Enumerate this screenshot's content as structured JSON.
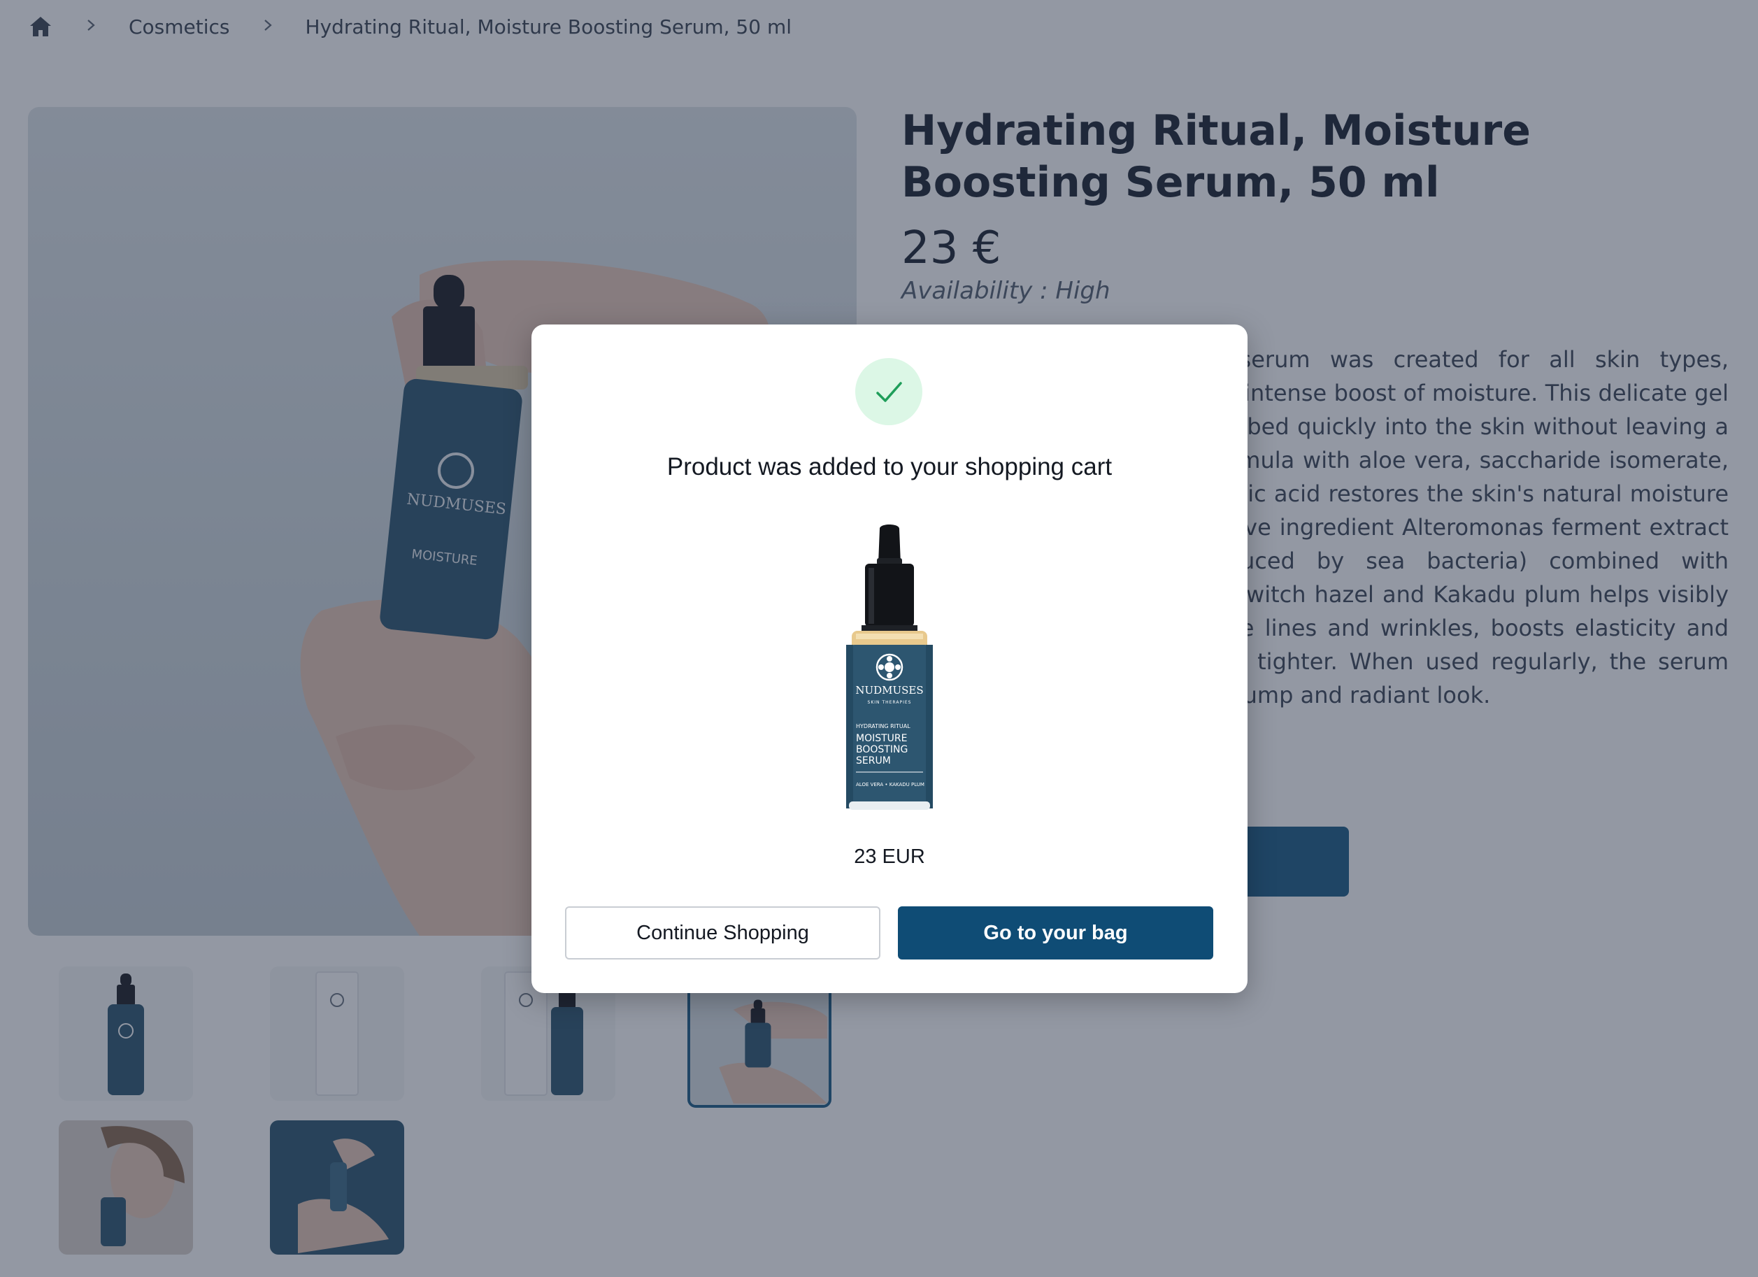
{
  "breadcrumb": {
    "home_icon": "home-icon",
    "separator_icon": "chevron-right-icon",
    "items": [
      "Cosmetics",
      "Hydrating Ritual, Moisture Boosting Serum, 50 ml"
    ]
  },
  "product": {
    "title": "Hydrating Ritual, Moisture Boosting Serum, 50 ml",
    "price": "23 €",
    "availability": "Availability : High",
    "description": "This lightweight hydrating serum was created for all skin types, especially those in need of an intense boost of moisture. This delicate gel spreads smoothly and is absorbed quickly into the skin without leaving a sticky residue. The oil-free formula with aloe vera, saccharide isomerate, low molecular weight hyaluronic acid restores the skin's natural moisture and soothes the skin. The active ingredient Alteromonas ferment extract (an exopolysaccharide produced by sea bacteria) combined with antioxidant-rich extracts from witch hazel and Kakadu plum helps visibly reduce the appearance of fine lines and wrinkles, boosts elasticity and makes the skin look and feel tighter. When used regularly, the serum leaves the skin with a fresh, plump and radiant look.",
    "brand_label": {
      "brand": "NUDMUSES",
      "brand_sub": "SKIN THERAPIES",
      "line": "HYDRATING RITUAL",
      "name_line1": "MOISTURE",
      "name_line2": "BOOSTING",
      "name_line3": "SERUM",
      "ingredients": "ALOE VERA • KAKADU PLUM"
    }
  },
  "modal": {
    "icon": "check-icon",
    "title": "Product was added to your shopping cart",
    "price": "23 EUR",
    "continue_label": "Continue Shopping",
    "bag_label": "Go to your bag"
  },
  "colors": {
    "primary": "#0f4c75",
    "success_bg": "#dcf7e6",
    "success_check": "#1f9e5a",
    "overlay": "rgba(34,44,68,0.49)",
    "bottle_label": "#2d5670"
  }
}
